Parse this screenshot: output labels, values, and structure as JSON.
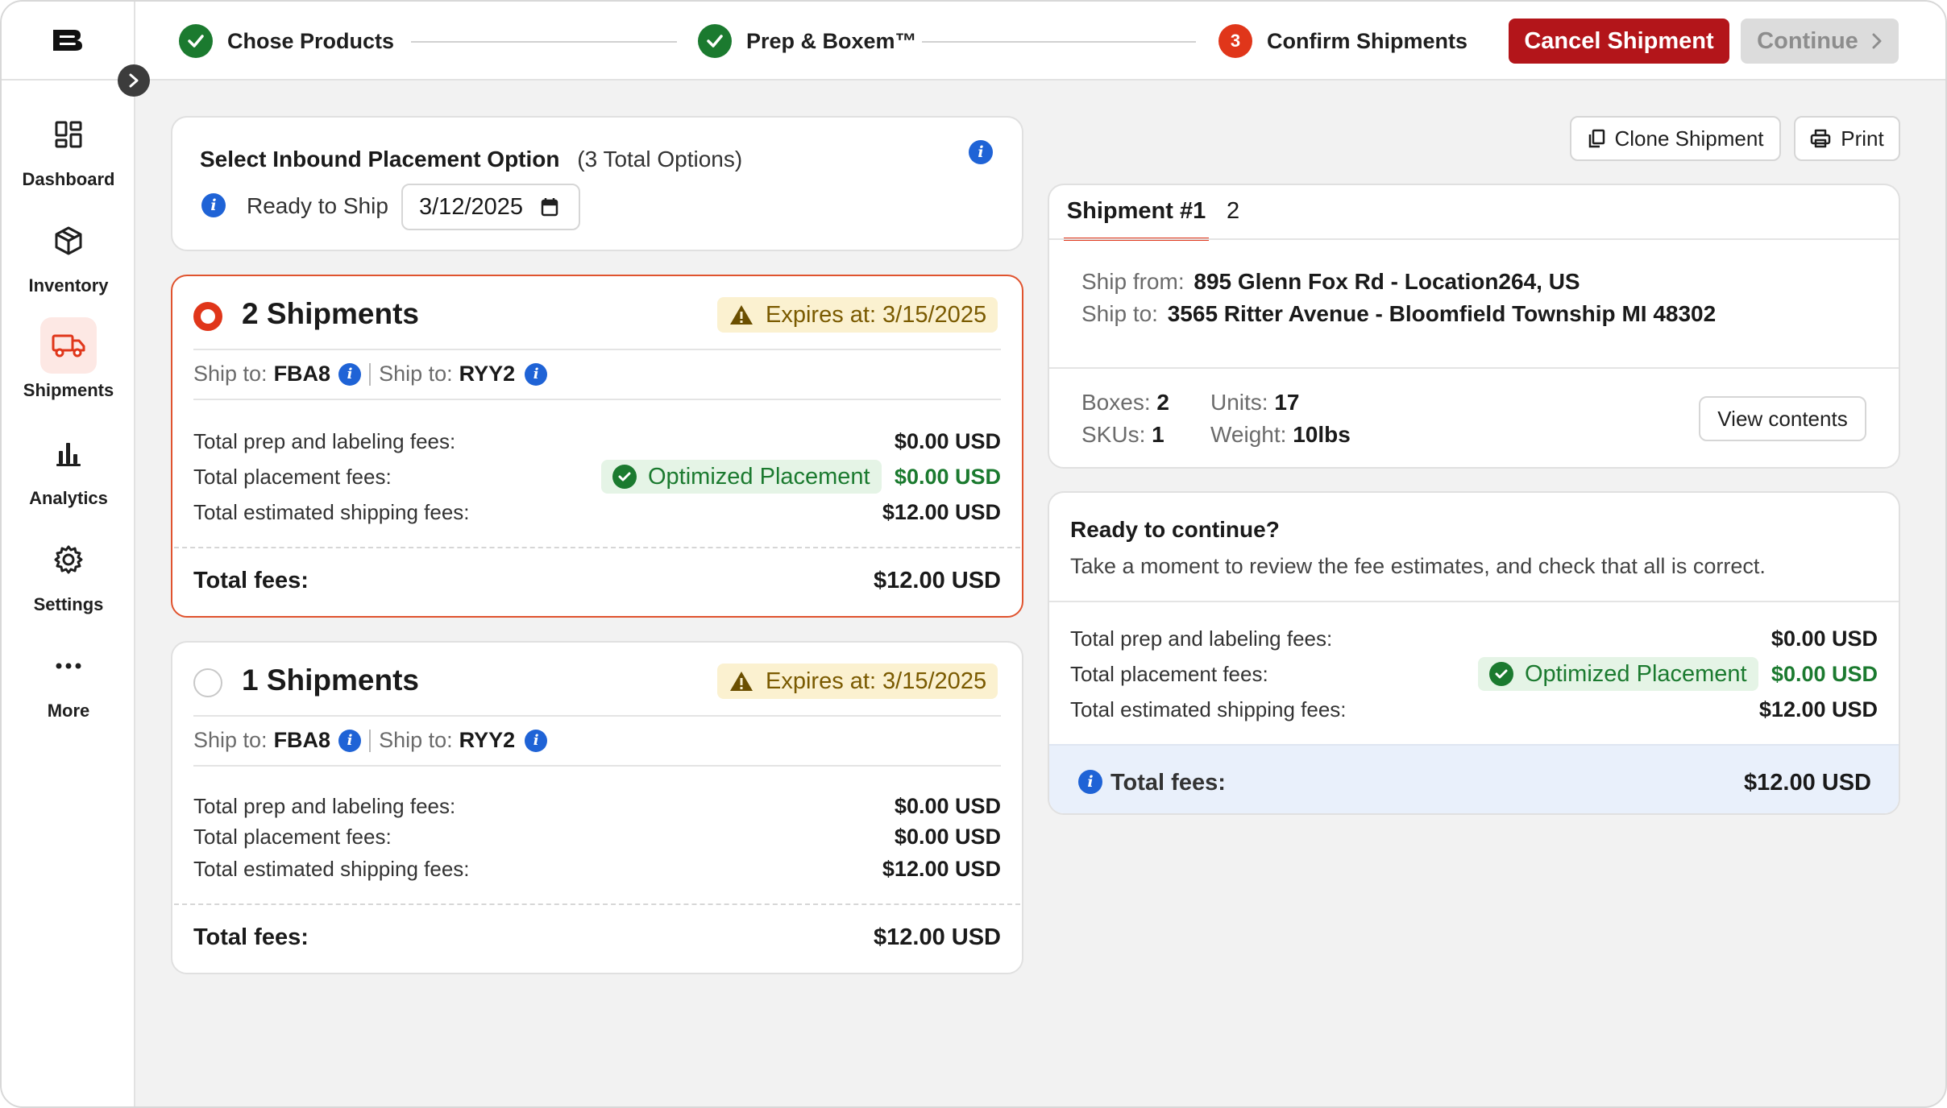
{
  "app": {
    "logo_letter": "B"
  },
  "sidebar": {
    "items": [
      {
        "label": "Dashboard",
        "icon": "dashboard-icon",
        "active": false
      },
      {
        "label": "Inventory",
        "icon": "box-icon",
        "active": false
      },
      {
        "label": "Shipments",
        "icon": "truck-icon",
        "active": true
      },
      {
        "label": "Analytics",
        "icon": "bar-chart-icon",
        "active": false
      },
      {
        "label": "Settings",
        "icon": "gear-icon",
        "active": false
      },
      {
        "label": "More",
        "icon": "more-icon",
        "active": false
      }
    ]
  },
  "stepper": {
    "steps": [
      {
        "label": "Chose Products",
        "status": "done"
      },
      {
        "label": "Prep & Boxem™",
        "status": "done"
      },
      {
        "label": "Confirm Shipments",
        "status": "current",
        "number": "3"
      }
    ],
    "cancel_label": "Cancel Shipment",
    "continue_label": "Continue"
  },
  "placement": {
    "title": "Select Inbound Placement Option",
    "total_options": "(3 Total Options)",
    "ready_label": "Ready to Ship",
    "date": "3/12/2025"
  },
  "options": [
    {
      "title": "2 Shipments",
      "selected": true,
      "expires": "Expires at: 3/15/2025",
      "ship_to_label": "Ship to:",
      "ship_to_1": "FBA8",
      "ship_to_2": "RYY2",
      "fees": {
        "prep_label": "Total prep and labeling fees:",
        "prep_value": "$0.00 USD",
        "placement_label": "Total placement fees:",
        "placement_badge": "Optimized Placement",
        "placement_value": "$0.00 USD",
        "shipping_label": "Total estimated shipping fees:",
        "shipping_value": "$12.00 USD",
        "total_label": "Total fees:",
        "total_value": "$12.00 USD"
      }
    },
    {
      "title": "1 Shipments",
      "selected": false,
      "expires": "Expires at: 3/15/2025",
      "ship_to_label": "Ship to:",
      "ship_to_1": "FBA8",
      "ship_to_2": "RYY2",
      "fees": {
        "prep_label": "Total prep and labeling fees:",
        "prep_value": "$0.00 USD",
        "placement_label": "Total placement fees:",
        "placement_value": "$0.00 USD",
        "shipping_label": "Total estimated shipping fees:",
        "shipping_value": "$12.00 USD",
        "total_label": "Total fees:",
        "total_value": "$12.00 USD"
      }
    }
  ],
  "actions": {
    "clone_label": "Clone Shipment",
    "print_label": "Print"
  },
  "shipment_detail": {
    "tabs": [
      "Shipment #1",
      "2"
    ],
    "ship_from_label": "Ship from:",
    "ship_from": "895 Glenn Fox Rd - Location264, US",
    "ship_to_label": "Ship to:",
    "ship_to": "3565 Ritter Avenue - Bloomfield Township MI 48302",
    "boxes_label": "Boxes:",
    "boxes": "2",
    "skus_label": "SKUs:",
    "skus": "1",
    "units_label": "Units:",
    "units": "17",
    "weight_label": "Weight:",
    "weight": "10lbs",
    "view_contents_label": "View contents"
  },
  "summary": {
    "title": "Ready to continue?",
    "subtitle": "Take a moment to review the fee estimates, and check that all is correct.",
    "prep_label": "Total prep and labeling fees:",
    "prep_value": "$0.00 USD",
    "placement_label": "Total placement fees:",
    "placement_badge": "Optimized Placement",
    "placement_value": "$0.00 USD",
    "shipping_label": "Total estimated shipping fees:",
    "shipping_value": "$12.00 USD",
    "total_label": "Total fees:",
    "total_value": "$12.00 USD"
  },
  "colors": {
    "accent": "#e0361a",
    "cancel": "#b3151a",
    "success": "#1b7a2f",
    "info": "#1f63d6"
  }
}
